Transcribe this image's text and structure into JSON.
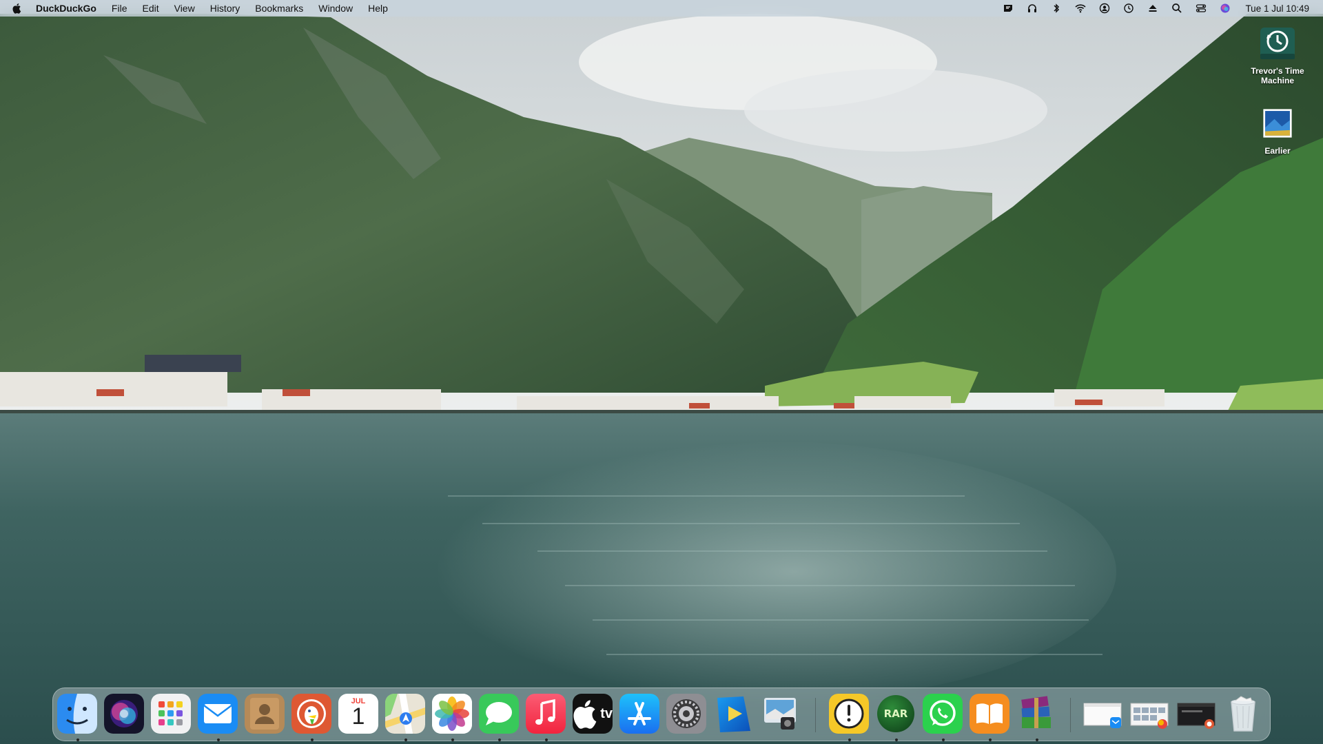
{
  "menubar": {
    "app_name": "DuckDuckGo",
    "menus": [
      "File",
      "Edit",
      "View",
      "History",
      "Bookmarks",
      "Window",
      "Help"
    ],
    "clock": "Tue 1 Jul  10:49",
    "status_icons": [
      "duckduckgo-vpn-icon",
      "headphones-icon",
      "bluetooth-icon",
      "wifi-icon",
      "user-account-icon",
      "time-machine-icon",
      "eject-icon",
      "spotlight-search-icon",
      "control-center-icon",
      "siri-icon"
    ]
  },
  "desktop": {
    "icons": [
      {
        "label": "Trevor's Time Machine",
        "icon": "time-machine-drive-icon"
      },
      {
        "label": "Earlier",
        "icon": "image-file-icon"
      }
    ]
  },
  "dock": {
    "apps": [
      {
        "name": "Finder",
        "icon": "finder-icon",
        "running": true
      },
      {
        "name": "Siri",
        "icon": "siri-icon",
        "running": false
      },
      {
        "name": "Launchpad",
        "icon": "launchpad-icon",
        "running": false
      },
      {
        "name": "Mail",
        "icon": "mail-icon",
        "running": true
      },
      {
        "name": "Contacts",
        "icon": "contacts-icon",
        "running": false
      },
      {
        "name": "DuckDuckGo",
        "icon": "duckduckgo-icon",
        "running": true
      },
      {
        "name": "Calendar",
        "icon": "calendar-icon",
        "running": false,
        "month": "JUL",
        "day": "1"
      },
      {
        "name": "Maps",
        "icon": "maps-icon",
        "running": true
      },
      {
        "name": "Photos",
        "icon": "photos-icon",
        "running": true
      },
      {
        "name": "Messages",
        "icon": "messages-icon",
        "running": true
      },
      {
        "name": "Music",
        "icon": "music-icon",
        "running": true
      },
      {
        "name": "TV",
        "icon": "apple-tv-icon",
        "running": false,
        "label": "tv"
      },
      {
        "name": "App Store",
        "icon": "app-store-icon",
        "running": false
      },
      {
        "name": "System Settings",
        "icon": "system-settings-icon",
        "running": false
      },
      {
        "name": "Infuse",
        "icon": "infuse-icon",
        "running": false
      },
      {
        "name": "Preview",
        "icon": "preview-icon",
        "running": false
      },
      {
        "name": "Console",
        "icon": "console-icon",
        "running": true
      },
      {
        "name": "RAR Extractor",
        "icon": "rar-extractor-icon",
        "running": true,
        "label": "RAR"
      },
      {
        "name": "WhatsApp",
        "icon": "whatsapp-icon",
        "running": true
      },
      {
        "name": "Books",
        "icon": "books-icon",
        "running": true
      },
      {
        "name": "WinRAR",
        "icon": "winrar-icon",
        "running": true
      }
    ],
    "recent": [
      {
        "name": "Mail window",
        "icon": "minimized-window-icon"
      },
      {
        "name": "Photos window",
        "icon": "minimized-window-icon"
      },
      {
        "name": "DuckDuckGo window",
        "icon": "minimized-window-icon"
      }
    ],
    "trash": {
      "name": "Trash",
      "icon": "trash-icon"
    }
  },
  "colors": {
    "menubar_bg": "#c8d4de",
    "sky": "#dfe4e6",
    "mountain_dark": "#2f4a34",
    "mountain_mid": "#4d6b48",
    "water": "#3c625f"
  }
}
